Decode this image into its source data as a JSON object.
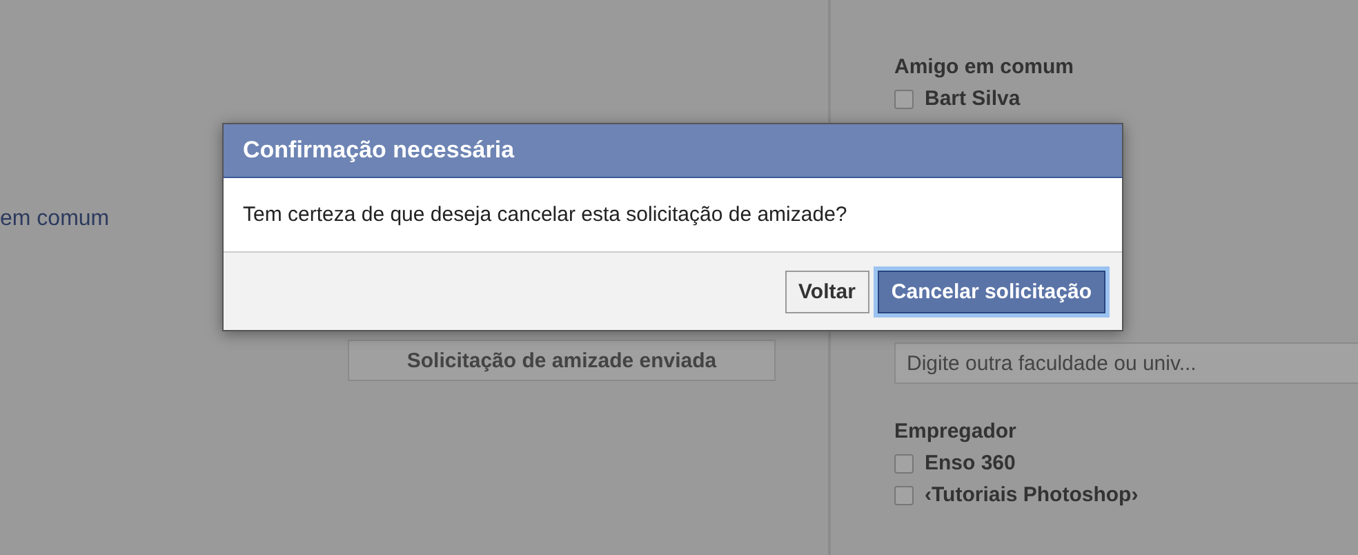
{
  "background": {
    "left": {
      "texts": [
        "em comum"
      ],
      "request_button": "Solicitação de amizade enviada"
    },
    "sidebar": {
      "mutual_heading": "Amigo em comum",
      "mutual_items": [
        {
          "label": "Bart Silva",
          "checked": false
        }
      ],
      "school_field": {
        "placeholder": "Digite outra faculdade ou univ..."
      },
      "employer_heading": "Empregador",
      "employer_items": [
        {
          "label": "Enso 360",
          "checked": false
        },
        {
          "label": "‹Tutoriais Photoshop›",
          "checked": false
        }
      ]
    }
  },
  "dialog": {
    "title": "Confirmação necessária",
    "message": "Tem certeza de que deseja cancelar esta solicitação de amizade?",
    "buttons": [
      {
        "label": "Voltar",
        "kind": "secondary"
      },
      {
        "label": "Cancelar solicitação",
        "kind": "primary"
      }
    ]
  }
}
